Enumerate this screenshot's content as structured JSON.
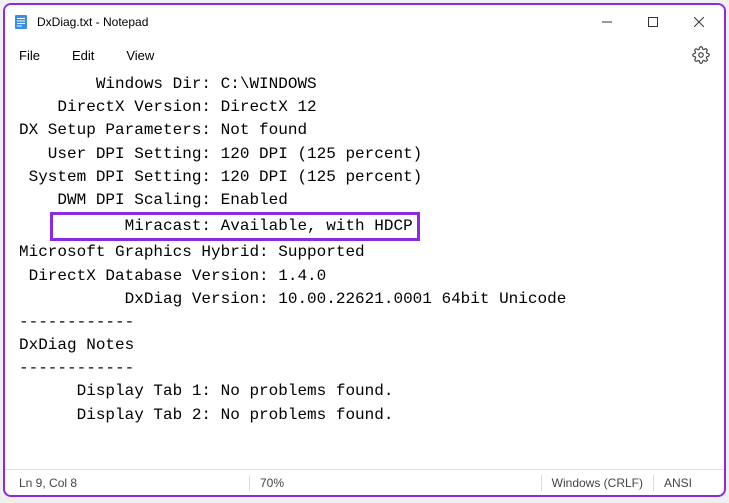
{
  "window": {
    "title": "DxDiag.txt - Notepad"
  },
  "menu": {
    "file": "File",
    "edit": "Edit",
    "view": "View"
  },
  "content": {
    "lines": [
      "        Windows Dir: C:\\WINDOWS",
      "    DirectX Version: DirectX 12",
      "DX Setup Parameters: Not found",
      "   User DPI Setting: 120 DPI (125 percent)",
      " System DPI Setting: 120 DPI (125 percent)",
      "    DWM DPI Scaling: Enabled",
      "           Miracast: Available, with HDCP",
      "Microsoft Graphics Hybrid: Supported",
      " DirectX Database Version: 1.4.0",
      "           DxDiag Version: 10.00.22621.0001 64bit Unicode",
      "",
      "------------",
      "DxDiag Notes",
      "------------",
      "      Display Tab 1: No problems found.",
      "      Display Tab 2: No problems found."
    ],
    "highlightIndex": 6,
    "highlightLabel": "           Miracast:",
    "highlightValue": " Available, with HDCP"
  },
  "status": {
    "position": "Ln 9, Col 8",
    "zoom": "70%",
    "lineEnding": "Windows (CRLF)",
    "encoding": "ANSI"
  }
}
